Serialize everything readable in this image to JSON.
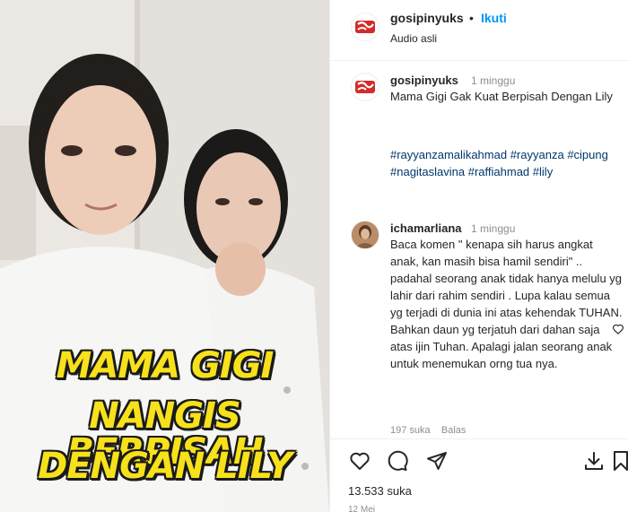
{
  "post": {
    "username": "gosipinyuks",
    "follow_label": "Ikuti",
    "dot": "•",
    "audio": "Audio asli",
    "overlay_caption": [
      "MAMA GIGI",
      "NANGIS BERPISAH",
      "DENGAN LILY"
    ]
  },
  "caption": {
    "username": "gosipinyuks",
    "time": "1 minggu",
    "text": "Mama Gigi Gak Kuat Berpisah Dengan Lily",
    "hashtags": [
      "#rayyanzamalikahmad",
      "#rayyanza",
      "#cipung",
      "#nagitaslavina",
      "#raffiahmad",
      "#lily"
    ]
  },
  "comment": {
    "username": "ichamarliana",
    "time": "1 minggu",
    "text": "Baca komen \" kenapa sih harus angkat anak, kan masih bisa hamil sendiri\" .. padahal seorang anak tidak hanya melulu yg lahir dari rahim sendiri . Lupa kalau semua yg terjadi di dunia ini atas kehendak TUHAN. Bahkan daun yg terjatuh dari dahan saja atas ijin Tuhan. Apalagi jalan seorang anak untuk menemukan orng tua nya.",
    "likes": "197 suka",
    "reply": "Balas"
  },
  "footer": {
    "likes": "13.533 suka",
    "date": "12 Mei"
  },
  "icons": {
    "like": "heart-icon",
    "comment": "comment-icon",
    "share": "send-icon",
    "download": "download-icon",
    "save": "bookmark-icon"
  },
  "colors": {
    "accent": "#0095f6",
    "hashtag": "#00376b",
    "muted": "#8e8e8e",
    "brand_red": "#d42a2a",
    "overlay_text": "#f7e11b"
  }
}
